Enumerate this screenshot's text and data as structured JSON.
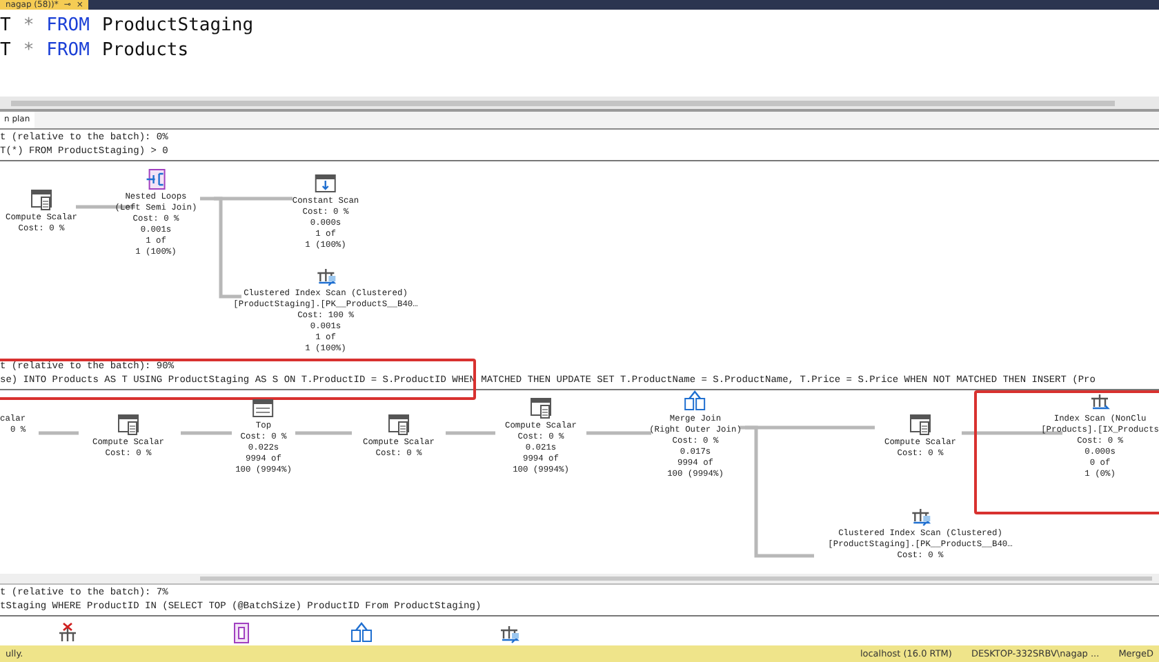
{
  "document_tab": {
    "title": "nagap (58))*",
    "pin": "⊸",
    "close": "×"
  },
  "editor": {
    "lines": [
      [
        {
          "kind": "plain",
          "text": "T"
        },
        {
          "kind": "operator",
          "text": "*"
        },
        {
          "kind": "keyword",
          "text": "FROM"
        },
        {
          "kind": "plain",
          "text": "ProductStaging"
        }
      ],
      [
        {
          "kind": "plain",
          "text": "T"
        },
        {
          "kind": "operator",
          "text": "*"
        },
        {
          "kind": "keyword",
          "text": "FROM"
        },
        {
          "kind": "plain",
          "text": "Products"
        }
      ]
    ]
  },
  "results_tab": {
    "label": "n plan",
    "selected": true
  },
  "queries": [
    {
      "cost": "t (relative to the batch): 0%",
      "statement": "T(*) FROM ProductStaging) > 0",
      "highlighted": false,
      "nodes": [
        {
          "kind": "compute-scalar",
          "lines": [
            "Compute Scalar",
            "Cost: 0 %"
          ],
          "highlighted": false
        },
        {
          "kind": "nested-loops",
          "lines": [
            "Nested Loops",
            "(Left Semi Join)",
            "Cost: 0 %",
            "0.001s",
            "1 of",
            "1 (100%)"
          ],
          "highlighted": false
        },
        {
          "kind": "constant-scan",
          "lines": [
            "Constant Scan",
            "Cost: 0 %",
            "0.000s",
            "1 of",
            "1 (100%)"
          ],
          "highlighted": false
        },
        {
          "kind": "clustered-index-scan",
          "lines": [
            "Clustered Index Scan (Clustered)",
            "[ProductStaging].[PK__ProductS__B40…",
            "Cost: 100 %",
            "0.001s",
            "1 of",
            "1 (100%)"
          ],
          "highlighted": false
        }
      ]
    },
    {
      "cost": "t (relative to the batch): 90%",
      "statement": "se) INTO Products AS T USING ProductStaging AS S ON T.ProductID = S.ProductID WHEN MATCHED THEN UPDATE SET T.ProductName = S.ProductName, T.Price = S.Price WHEN NOT MATCHED THEN INSERT (Pro",
      "highlighted": true,
      "nodes": [
        {
          "kind": "none",
          "lines": [
            "calar",
            "0 %"
          ],
          "highlighted": false
        },
        {
          "kind": "compute-scalar",
          "lines": [
            "Compute Scalar",
            "Cost: 0 %"
          ],
          "highlighted": false
        },
        {
          "kind": "top",
          "lines": [
            "Top",
            "Cost: 0 %",
            "0.022s",
            "9994 of",
            "100 (9994%)"
          ],
          "highlighted": false
        },
        {
          "kind": "compute-scalar",
          "lines": [
            "Compute Scalar",
            "Cost: 0 %"
          ],
          "highlighted": false
        },
        {
          "kind": "compute-scalar",
          "lines": [
            "Compute Scalar",
            "Cost: 0 %",
            "0.021s",
            "9994 of",
            "100 (9994%)"
          ],
          "highlighted": false
        },
        {
          "kind": "merge-join",
          "lines": [
            "Merge Join",
            "(Right Outer Join)",
            "Cost: 0 %",
            "0.017s",
            "9994 of",
            "100 (9994%)"
          ],
          "highlighted": false
        },
        {
          "kind": "compute-scalar",
          "lines": [
            "Compute Scalar",
            "Cost: 0 %"
          ],
          "highlighted": false
        },
        {
          "kind": "index-scan",
          "lines": [
            "Index Scan (NonClu",
            "[Products].[IX_Products",
            "Cost: 0 %",
            "0.000s",
            "0 of",
            "1 (0%)"
          ],
          "highlighted": true
        },
        {
          "kind": "clustered-index-scan",
          "lines": [
            "Clustered Index Scan (Clustered)",
            "[ProductStaging].[PK__ProductS__B40…",
            "Cost: 0 %"
          ],
          "highlighted": false
        }
      ]
    },
    {
      "cost": "t (relative to the batch): 7%",
      "statement": "tStaging WHERE ProductID IN (SELECT TOP (@BatchSize) ProductID From ProductStaging)",
      "highlighted": false,
      "nodes": [
        {
          "kind": "clustered-index-delete",
          "highlighted": false
        },
        {
          "kind": "table-spool",
          "highlighted": false
        },
        {
          "kind": "merge-join",
          "highlighted": false
        },
        {
          "kind": "clustered-index-scan",
          "highlighted": false
        }
      ]
    }
  ],
  "status_bar": {
    "message": "ully.",
    "items": [
      "localhost (16.0 RTM)",
      "DESKTOP-332SRBV\\nagap ...",
      "MergeD"
    ]
  }
}
